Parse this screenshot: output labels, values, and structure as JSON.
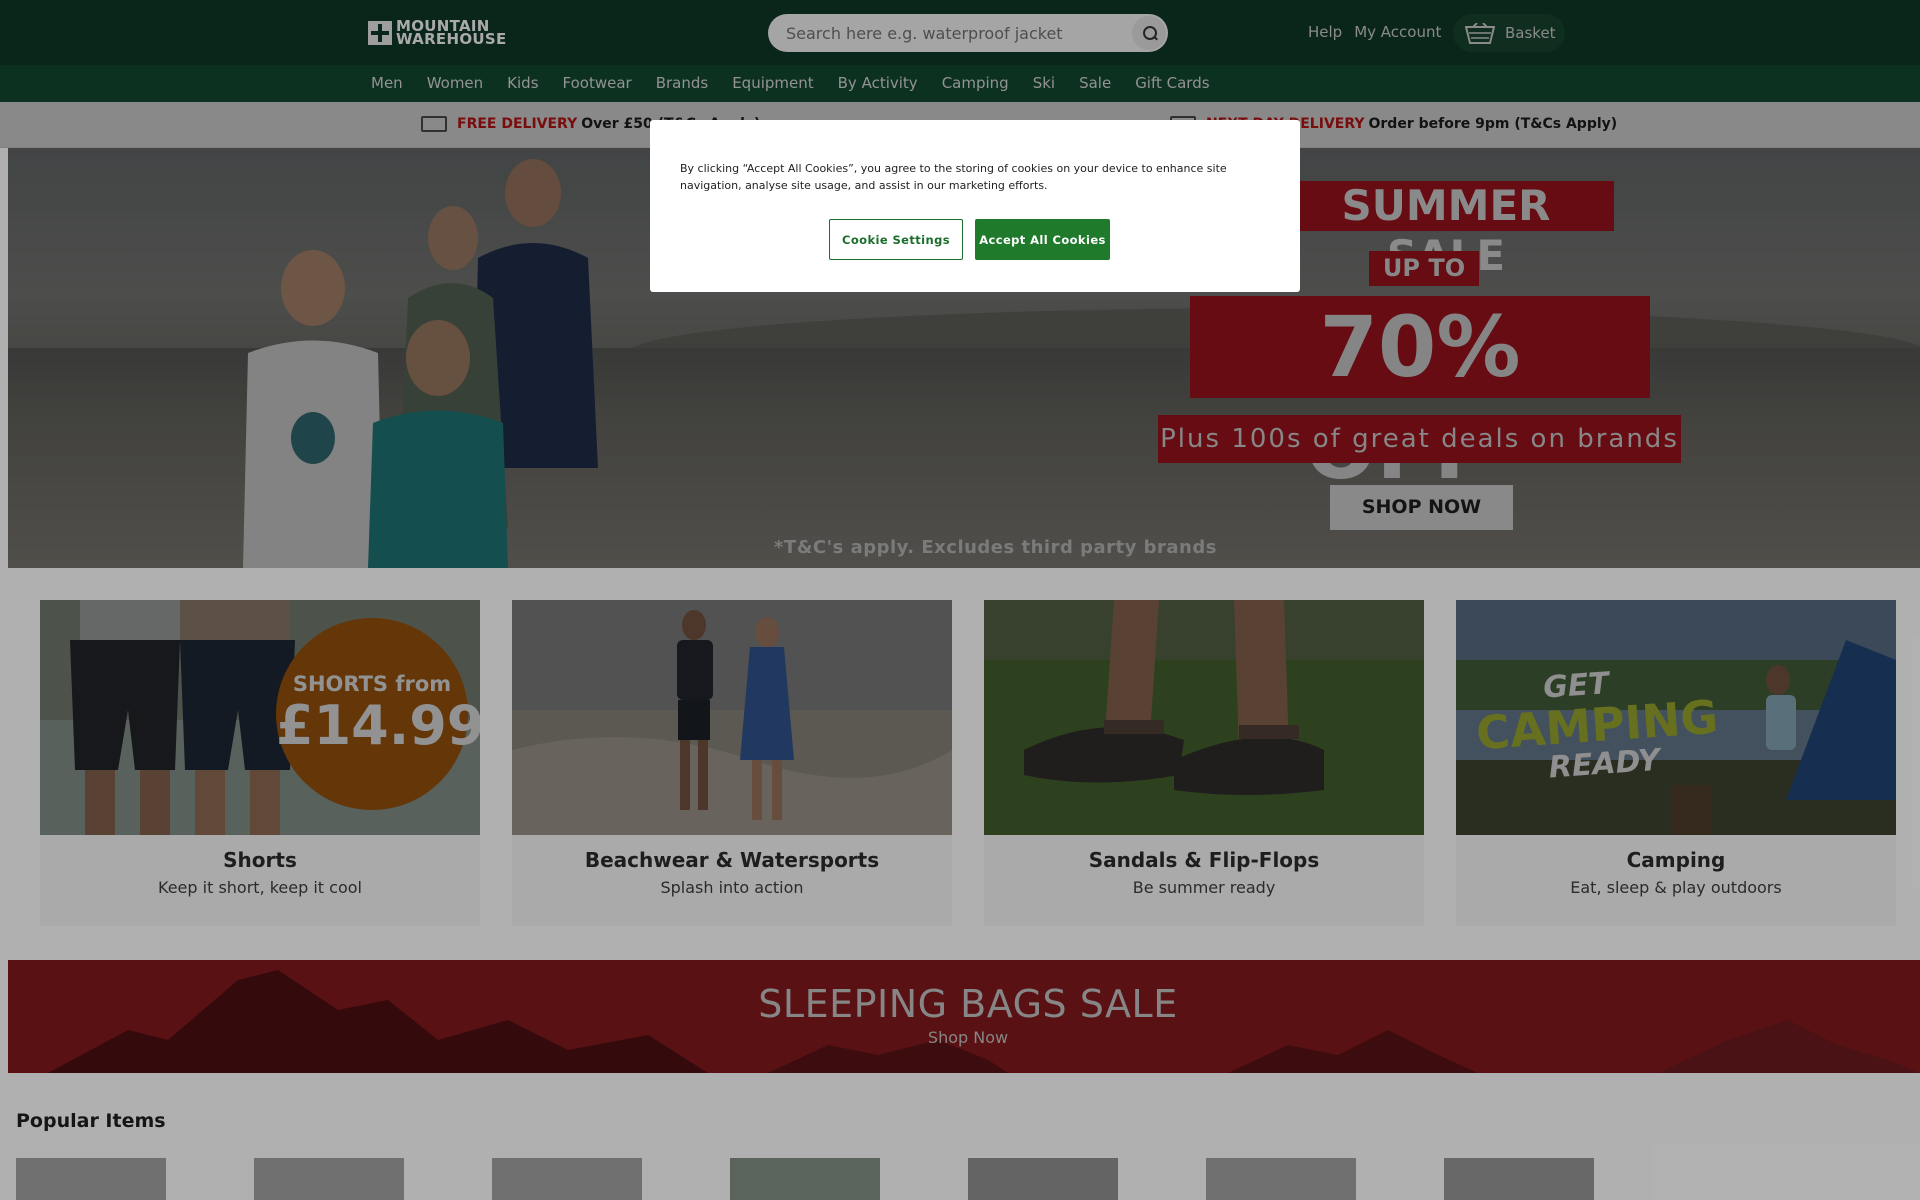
{
  "header": {
    "logo_line1": "MOUNTAIN",
    "logo_line2": "WAREHOUSE",
    "search_placeholder": "Search here e.g. waterproof jacket",
    "help": "Help",
    "account": "My Account",
    "basket": "Basket"
  },
  "nav": [
    "Men",
    "Women",
    "Kids",
    "Footwear",
    "Brands",
    "Equipment",
    "By Activity",
    "Camping",
    "Ski",
    "Sale",
    "Gift Cards"
  ],
  "usp": {
    "delivery_red": "FREE DELIVERY",
    "delivery_text": "Over £50  (T&Cs Apply)",
    "nextday_red": "NEXT DAY DELIVERY",
    "nextday_text": "Order before 9pm (T&Cs Apply)"
  },
  "hero": {
    "summer_sale": "SUMMER SALE",
    "up_to": "UP TO",
    "percent_off": "70% OFF*",
    "deals": "Plus 100s of great deals on brands",
    "shop_now": "SHOP NOW",
    "terms": "*T&C's apply. Excludes third party brands"
  },
  "cards": [
    {
      "title": "Shorts",
      "subtitle": "Keep it short, keep it cool",
      "badge_line1": "SHORTS from",
      "badge_line2": "£14.99"
    },
    {
      "title": "Beachwear & Watersports",
      "subtitle": "Splash into action"
    },
    {
      "title": "Sandals & Flip-Flops",
      "subtitle": "Be summer ready"
    },
    {
      "title": "Camping",
      "subtitle": "Eat, sleep & play outdoors",
      "overlay_line1": "GET",
      "overlay_line2": "CAMPING",
      "overlay_line3": "READY"
    }
  ],
  "bags_banner": {
    "title": "SLEEPING BAGS SALE",
    "link": "Shop Now"
  },
  "popular": {
    "title": "Popular Items"
  },
  "cookie": {
    "text": "By clicking “Accept All Cookies”, you agree to the storing of cookies on your device to enhance site navigation, analyse site usage, and assist in our marketing efforts.",
    "settings_label": "Cookie Settings",
    "accept_label": "Accept All Cookies"
  },
  "colors": {
    "header_bg": "#0f3525",
    "nav_bg": "#13442e",
    "sale_red": "#8f111b",
    "accept_green": "#1f7a2b"
  },
  "icons": [
    "logo-cross-icon",
    "search-icon",
    "basket-icon",
    "delivery-truck-icon",
    "next-day-icon"
  ]
}
